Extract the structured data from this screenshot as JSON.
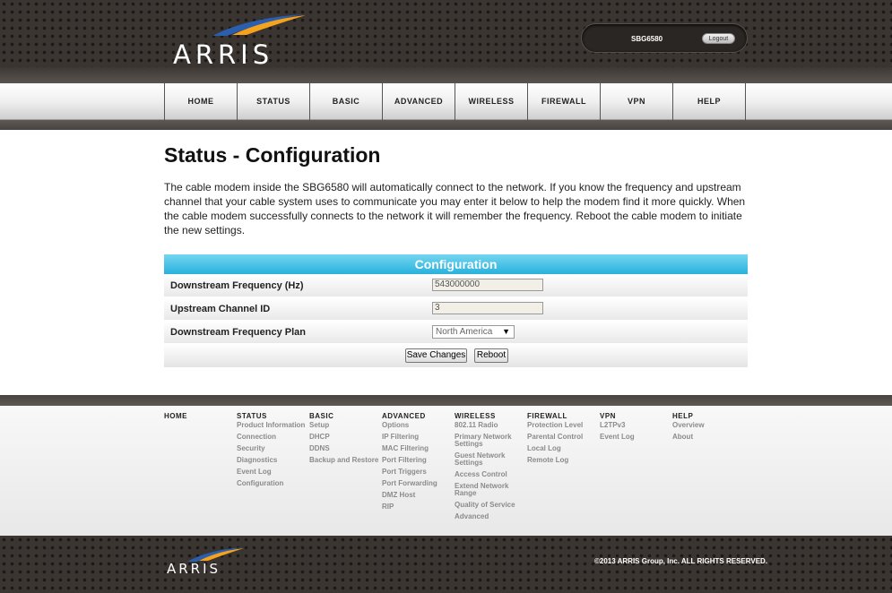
{
  "brand": {
    "logo_text": "ARRIS",
    "accent": "#28b1dd",
    "swoosh_blue": "#2a5fb0",
    "swoosh_orange": "#f5a21c"
  },
  "header": {
    "model": "SBG6580",
    "logout_label": "Logout"
  },
  "nav": [
    "HOME",
    "STATUS",
    "BASIC",
    "ADVANCED",
    "WIRELESS",
    "FIREWALL",
    "VPN",
    "HELP"
  ],
  "main": {
    "title": "Status - Configuration",
    "intro": "The cable modem inside the SBG6580 will automatically connect to the network. If you know the frequency and upstream channel that your cable system uses to communicate you may enter it below to help the modem find it more quickly. When the cable modem successfully connects to the network it will remember the frequency. Reboot the cable modem to initiate the new settings."
  },
  "config": {
    "header": "Configuration",
    "downstream_label": "Downstream Frequency (Hz)",
    "downstream_value": "543000000",
    "upstream_label": "Upstream Channel ID",
    "upstream_value": "3",
    "plan_label": "Downstream Frequency Plan",
    "plan_value": "North America",
    "save_label": "Save Changes",
    "reboot_label": "Reboot"
  },
  "footer_nav": [
    {
      "head": "HOME",
      "links": []
    },
    {
      "head": "STATUS",
      "links": [
        "Product Information",
        "Connection",
        "Security",
        "Diagnostics",
        "Event Log",
        "Configuration"
      ]
    },
    {
      "head": "BASIC",
      "links": [
        "Setup",
        "DHCP",
        "DDNS",
        "Backup and Restore"
      ]
    },
    {
      "head": "ADVANCED",
      "links": [
        "Options",
        "IP Filtering",
        "MAC Filtering",
        "Port Filtering",
        "Port Triggers",
        "Port Forwarding",
        "DMZ Host",
        "RIP"
      ]
    },
    {
      "head": "WIRELESS",
      "links": [
        "802.11 Radio",
        "Primary Network Settings",
        "Guest Network Settings",
        "Access Control",
        "Extend Network Range",
        "Quality of Service",
        "Advanced"
      ]
    },
    {
      "head": "FIREWALL",
      "links": [
        "Protection Level",
        "Parental Control",
        "Local Log",
        "Remote Log"
      ]
    },
    {
      "head": "VPN",
      "links": [
        "L2TPv3",
        "Event Log"
      ]
    },
    {
      "head": "HELP",
      "links": [
        "Overview",
        "About"
      ]
    }
  ],
  "footer": {
    "copyright": "©2013 ARRIS Group, Inc. ALL RIGHTS RESERVED."
  }
}
